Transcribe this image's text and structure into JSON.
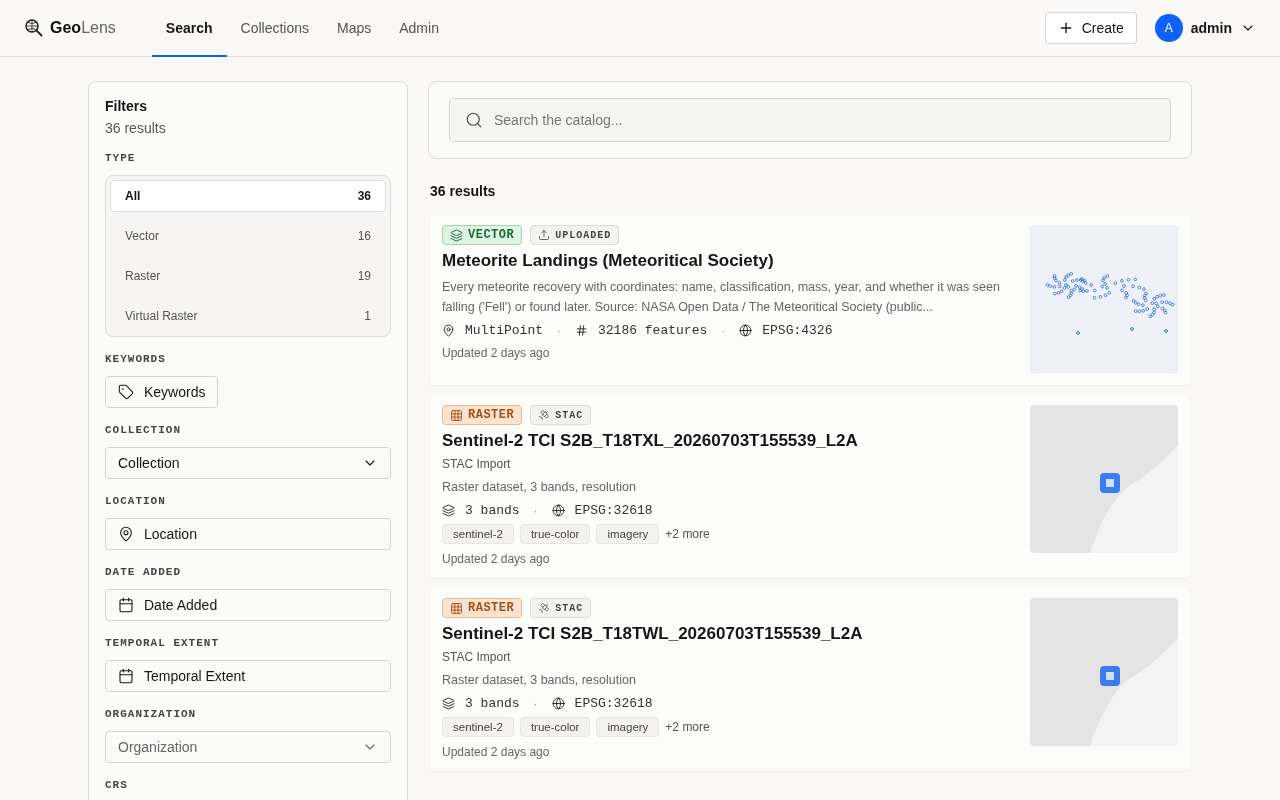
{
  "brand": {
    "bold": "Geo",
    "light": "Lens"
  },
  "nav": [
    {
      "label": "Search",
      "selected": true
    },
    {
      "label": "Collections",
      "selected": false
    },
    {
      "label": "Maps",
      "selected": false
    },
    {
      "label": "Admin",
      "selected": false
    }
  ],
  "create_button": "Create",
  "user": {
    "initial": "A",
    "name": "admin"
  },
  "filters": {
    "title": "Filters",
    "count": "36 results",
    "sections": [
      {
        "kind": "options",
        "label": "TYPE",
        "options": [
          {
            "label": "All",
            "count": "36",
            "selected": true
          },
          {
            "label": "Vector",
            "count": "16",
            "selected": false
          },
          {
            "label": "Raster",
            "count": "19",
            "selected": false
          },
          {
            "label": "Virtual Raster",
            "count": "1",
            "selected": false
          }
        ]
      },
      {
        "kind": "keywords",
        "label": "KEYWORDS",
        "text": "Keywords"
      },
      {
        "kind": "select",
        "label": "COLLECTION",
        "value": "Collection"
      },
      {
        "kind": "location",
        "label": "LOCATION",
        "text": "Location"
      },
      {
        "kind": "date",
        "label": "DATE ADDED",
        "text": "Date Added"
      },
      {
        "kind": "date",
        "label": "TEMPORAL EXTENT",
        "text": "Temporal Extent"
      },
      {
        "kind": "select",
        "label": "ORGANIZATION",
        "placeholder": "Organization"
      },
      {
        "kind": "label",
        "label": "CRS"
      }
    ]
  },
  "search": {
    "placeholder": "Search the catalog..."
  },
  "results_count": "36 results",
  "results": [
    {
      "type": {
        "kind": "vector",
        "label": "VECTOR"
      },
      "source": {
        "kind": "uploaded",
        "label": "UPLOADED"
      },
      "title": "Meteorite Landings (Meteoritical Society)",
      "description": "Every meteorite recovery with coordinates: name, classification, mass, year, and whether it was seen falling ('Fell') or found later. Source: NASA Open Data / The Meteoritical Society (public...",
      "meta": [
        {
          "kind": "geometry",
          "text": "MultiPoint"
        },
        {
          "kind": "separator",
          "text": "·"
        },
        {
          "kind": "features",
          "text": "32186 features"
        },
        {
          "kind": "separator",
          "text": "·"
        },
        {
          "kind": "crs",
          "text": "EPSG:4326"
        }
      ],
      "updated": "Updated 2 days ago"
    },
    {
      "type": {
        "kind": "raster",
        "label": "RASTER"
      },
      "source": {
        "kind": "stac",
        "label": "STAC"
      },
      "title": "Sentinel-2 TCI S2B_T18TXL_20260703T155539_L2A",
      "subtitle": "STAC Import",
      "description": "Raster dataset, 3 bands, resolution",
      "meta": [
        {
          "kind": "bands",
          "text": "3 bands"
        },
        {
          "kind": "separator",
          "text": "·"
        },
        {
          "kind": "crs",
          "text": "EPSG:32618"
        }
      ],
      "tags": [
        "sentinel-2",
        "true-color",
        "imagery"
      ],
      "more": "+2 more",
      "updated": "Updated 2 days ago"
    },
    {
      "type": {
        "kind": "raster",
        "label": "RASTER"
      },
      "source": {
        "kind": "stac",
        "label": "STAC"
      },
      "title": "Sentinel-2 TCI S2B_T18TWL_20260703T155539_L2A",
      "subtitle": "STAC Import",
      "description": "Raster dataset, 3 bands, resolution",
      "meta": [
        {
          "kind": "bands",
          "text": "3 bands"
        },
        {
          "kind": "separator",
          "text": "·"
        },
        {
          "kind": "crs",
          "text": "EPSG:32618"
        }
      ],
      "tags": [
        "sentinel-2",
        "true-color",
        "imagery"
      ],
      "more": "+2 more",
      "updated": "Updated 2 days ago"
    }
  ]
}
